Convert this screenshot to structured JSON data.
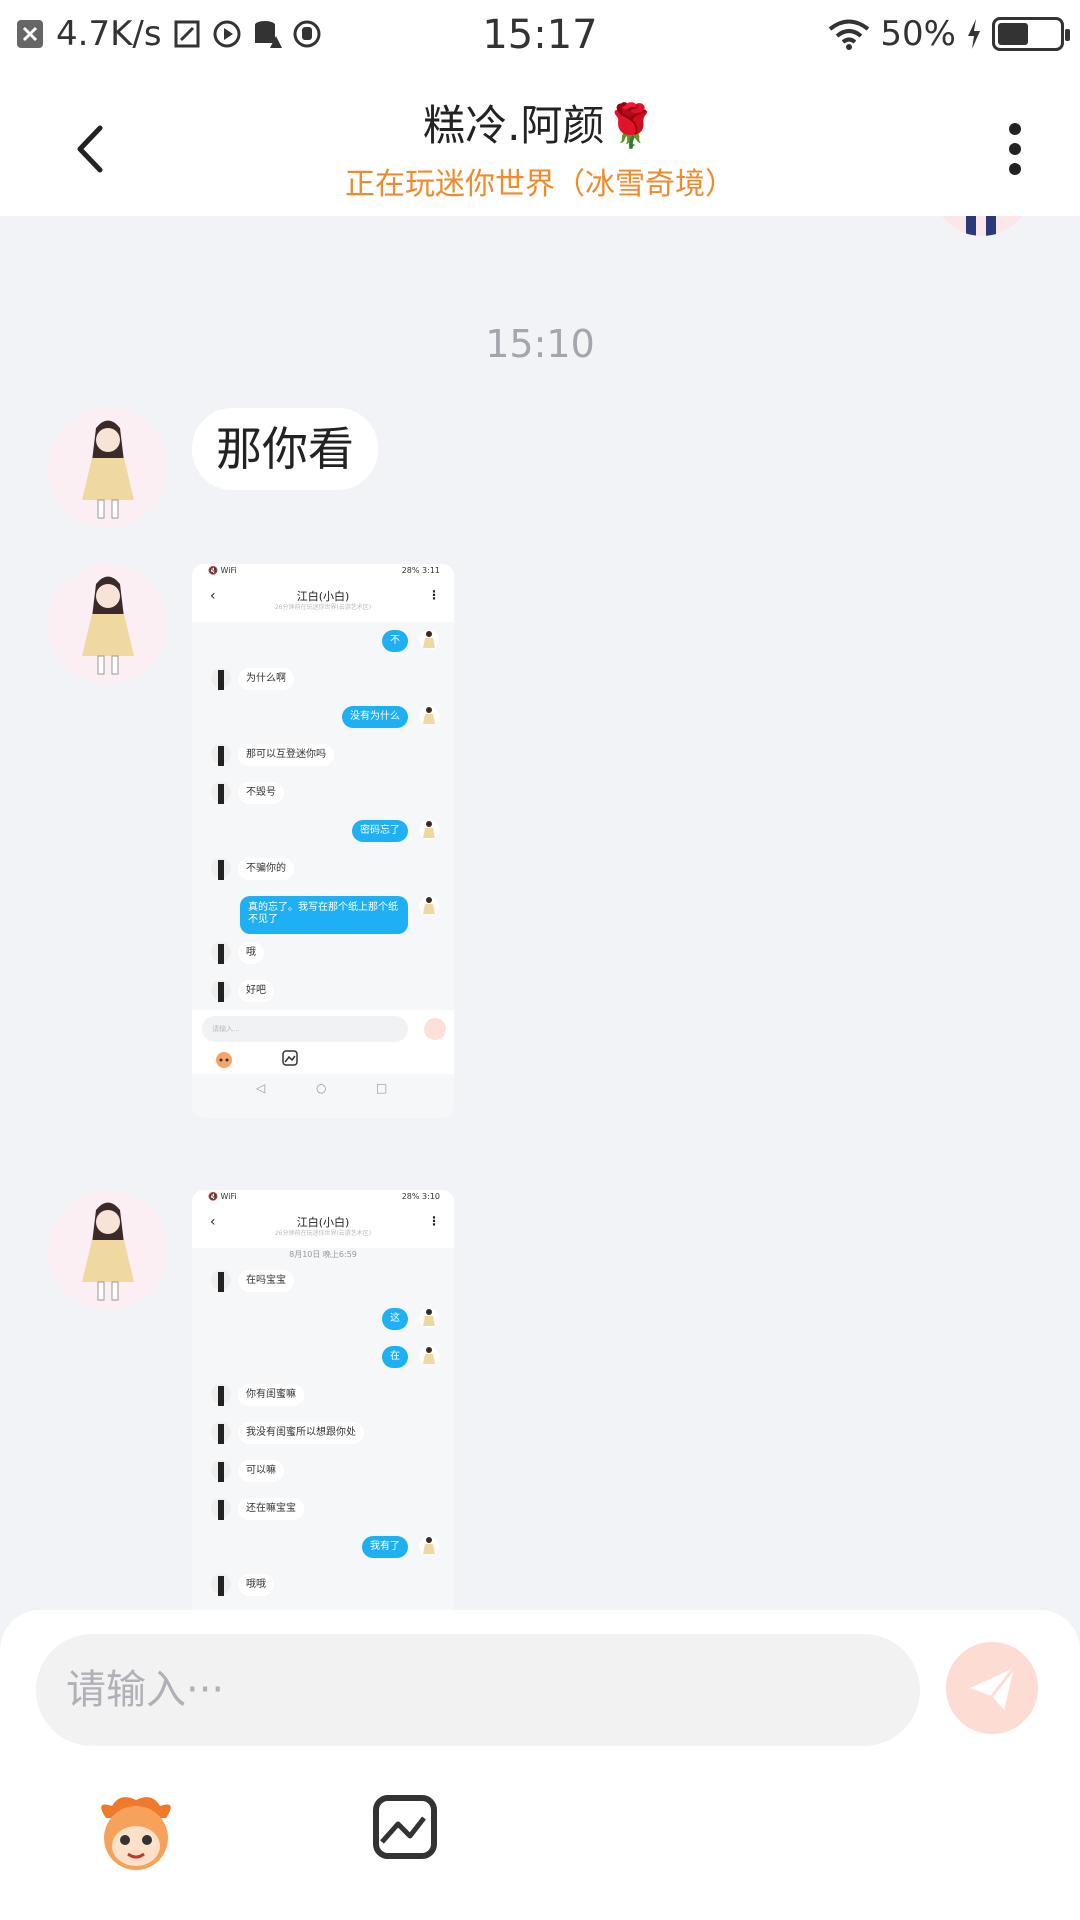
{
  "status_bar": {
    "net_speed": "4.7K/s",
    "time": "15:17",
    "battery": "50%",
    "battery_level": 0.5
  },
  "header": {
    "title": "糕冷.阿颜🌹",
    "subtitle": "正在玩迷你世界（冰雪奇境）"
  },
  "chat": {
    "timestamp": "15:10",
    "text_message": "那你看",
    "shot1": {
      "status_left": "🔇 WiFi",
      "status_right": "28% 3:11",
      "title": "江白(小白)",
      "subtitle": "26分钟前在玩迷你世界(云游艺术区)",
      "messages": [
        {
          "side": "right",
          "text": "不"
        },
        {
          "side": "left",
          "text": "为什么啊"
        },
        {
          "side": "right",
          "text": "没有为什么"
        },
        {
          "side": "left",
          "text": "那可以互登迷你吗"
        },
        {
          "side": "left",
          "text": "不毁号"
        },
        {
          "side": "right",
          "text": "密码忘了"
        },
        {
          "side": "left",
          "text": "不骗你的"
        },
        {
          "side": "right",
          "text": "真的忘了。我写在那个纸上那个纸不见了"
        },
        {
          "side": "left",
          "text": "哦"
        },
        {
          "side": "left",
          "text": "好吧"
        }
      ],
      "input_placeholder": "请输入..."
    },
    "shot2": {
      "status_right": "28% 3:10",
      "title": "江白(小白)",
      "subtitle": "26分钟前在玩迷你世界(云游艺术区)",
      "date": "8月10日 晚上6:59",
      "messages": [
        {
          "side": "left",
          "text": "在吗宝宝"
        },
        {
          "side": "right",
          "text": "这"
        },
        {
          "side": "right",
          "text": "在"
        },
        {
          "side": "left",
          "text": "你有闺蜜嘛"
        },
        {
          "side": "left",
          "text": "我没有闺蜜所以想跟你处"
        },
        {
          "side": "left",
          "text": "可以嘛"
        },
        {
          "side": "left",
          "text": "还在嘛宝宝"
        },
        {
          "side": "right",
          "text": "我有了"
        },
        {
          "side": "left",
          "text": "哦哦"
        }
      ]
    }
  },
  "input": {
    "placeholder": "请输入···"
  },
  "colors": {
    "accent_orange": "#f08a2c",
    "bubble_blue": "#1fb0f3",
    "send_pink": "#fddcd3"
  }
}
